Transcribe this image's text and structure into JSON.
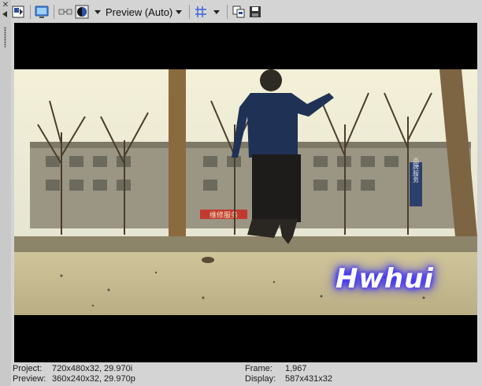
{
  "toolbar": {
    "preview_quality_label": "Preview (Auto)",
    "icons": [
      "video-output-icon",
      "monitor-icon",
      "split-screen-icon",
      "overlay-icon",
      "grid-icon",
      "copy-snapshot-icon",
      "save-snapshot-icon"
    ]
  },
  "video": {
    "overlay_text": "Hwhui",
    "sign_text": "维修服务",
    "vertical_sign": "品牌服务"
  },
  "status": {
    "project_label": "Project:",
    "project_value": "720x480x32, 29.970i",
    "preview_label": "Preview:",
    "preview_value": "360x240x32, 29.970p",
    "frame_label": "Frame:",
    "frame_value": "1,967",
    "display_label": "Display:",
    "display_value": "587x431x32"
  },
  "colors": {
    "background": "#d4d4d4",
    "viewport": "#000000",
    "overlay_glow": "#3a2cff"
  }
}
